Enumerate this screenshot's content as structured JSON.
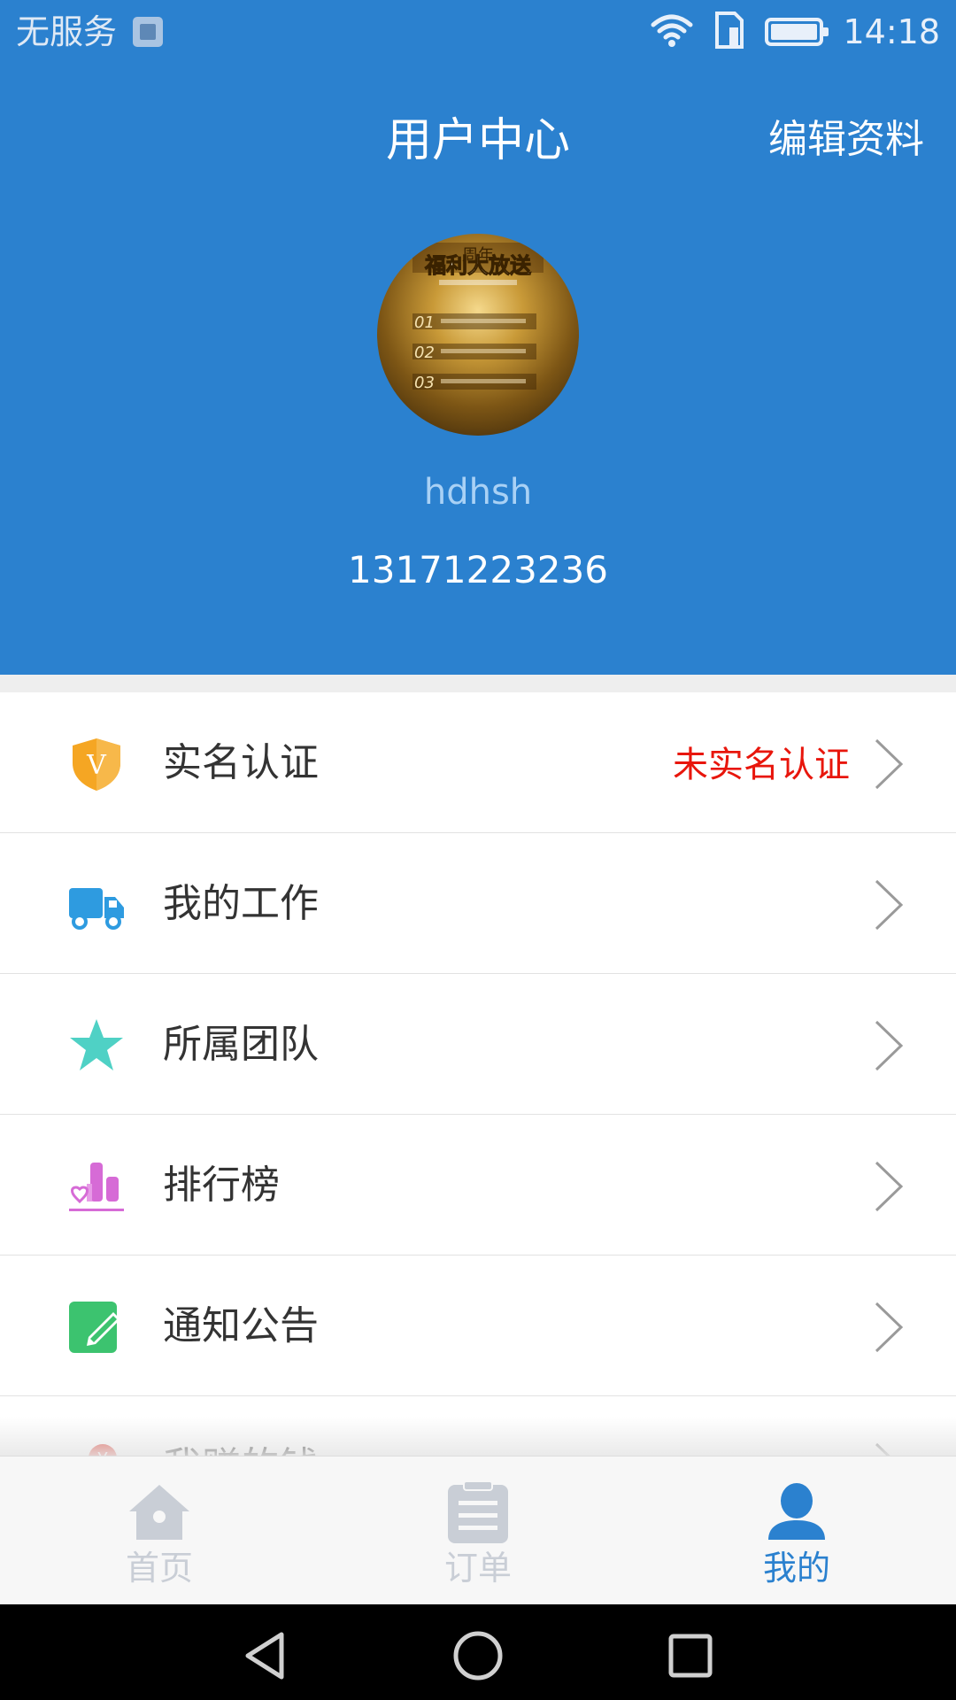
{
  "status_bar": {
    "carrier": "无服务",
    "time": "14:18",
    "icons": [
      "image-notification-icon",
      "wifi-icon",
      "sim-icon",
      "battery-icon"
    ]
  },
  "header": {
    "title": "用户中心",
    "edit_label": "编辑资料",
    "background_color": "#2b81cf",
    "avatar_text": {
      "headline": "福利大放送",
      "subheadline": "周年",
      "lines": [
        "01",
        "02",
        "03"
      ]
    },
    "username": "hdhsh",
    "phone": "13171223236"
  },
  "menu": [
    {
      "label": "实名认证",
      "value": "未实名认证",
      "icon": "shield-v-icon",
      "icon_color": "#f5a623"
    },
    {
      "label": "我的工作",
      "value": "",
      "icon": "truck-icon",
      "icon_color": "#2e9be0"
    },
    {
      "label": "所属团队",
      "value": "",
      "icon": "star-icon",
      "icon_color": "#4fd1c5"
    },
    {
      "label": "排行榜",
      "value": "",
      "icon": "ranking-chart-icon",
      "icon_color": "#d66bd6"
    },
    {
      "label": "通知公告",
      "value": "",
      "icon": "edit-note-icon",
      "icon_color": "#3cc36f"
    },
    {
      "label": "我赚的钱",
      "value": "",
      "icon": "money-icon",
      "icon_color": "#e0463c"
    }
  ],
  "tabs": [
    {
      "label": "首页",
      "icon": "home-icon",
      "active": false
    },
    {
      "label": "订单",
      "icon": "clipboard-icon",
      "active": false
    },
    {
      "label": "我的",
      "icon": "user-icon",
      "active": true
    }
  ],
  "colors": {
    "accent": "#2b81cf",
    "warning_text": "#e8160c",
    "tab_inactive": "#c9ced6"
  }
}
